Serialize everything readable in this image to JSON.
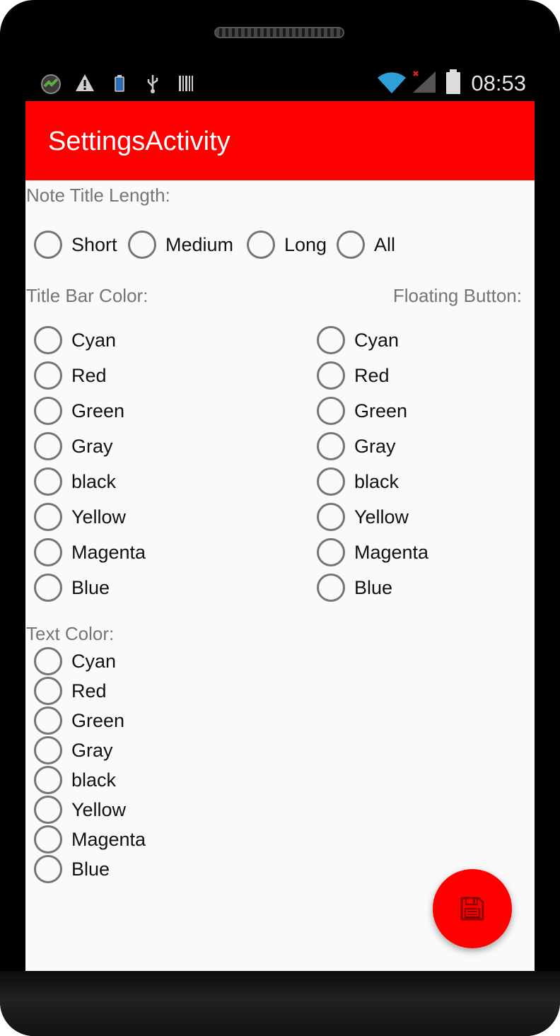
{
  "status_bar": {
    "time": "08:53",
    "icons": [
      "app-badge-icon",
      "warning-icon",
      "battery-small-icon",
      "usb-icon",
      "barcode-icon",
      "wifi-icon",
      "signal-no-data-icon",
      "battery-icon"
    ]
  },
  "app_bar": {
    "title": "SettingsActivity",
    "color": "#ff0000"
  },
  "note_title_length": {
    "label": "Note Title Length:",
    "options": [
      "Short",
      "Medium",
      "Long",
      "All"
    ]
  },
  "title_bar_color": {
    "label": "Title Bar Color:",
    "options": [
      "Cyan",
      "Red",
      "Green",
      "Gray",
      "black",
      "Yellow",
      "Magenta",
      "Blue"
    ]
  },
  "floating_button": {
    "label": "Floating Button:",
    "options": [
      "Cyan",
      "Red",
      "Green",
      "Gray",
      "black",
      "Yellow",
      "Magenta",
      "Blue"
    ]
  },
  "text_color": {
    "label": "Text Color:",
    "options": [
      "Cyan",
      "Red",
      "Green",
      "Gray",
      "black",
      "Yellow",
      "Magenta",
      "Blue"
    ]
  },
  "fab": {
    "icon": "save-icon",
    "color": "#ff0000"
  }
}
